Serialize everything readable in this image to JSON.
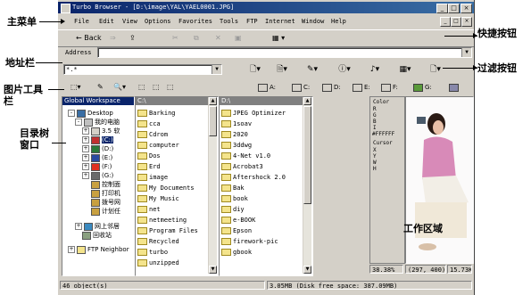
{
  "window": {
    "title": "Turbo Browser - [D:\\image\\YAL\\YAEL0001.JPG]",
    "controls": [
      "_",
      "□",
      "×"
    ],
    "mdi_controls": [
      "_",
      "□",
      "×"
    ]
  },
  "menu": [
    "File",
    "Edit",
    "View",
    "Options",
    "Favorites",
    "Tools",
    "FTP",
    "Internet",
    "Window",
    "Help"
  ],
  "toolbar": {
    "back_label": "← Back",
    "forward": "⇒",
    "up": "⇪",
    "cut": "✂",
    "copy": "⧉",
    "delete": "✕",
    "properties": "▣",
    "view": "▦ ▾"
  },
  "address": {
    "label": "Address",
    "value": ""
  },
  "filter": {
    "value": "*.*",
    "buttons": [
      "🗋▾",
      "🗎▾",
      "✎▾",
      "ⓘ▾",
      "♪▾",
      "▦▾",
      "🗋▾"
    ]
  },
  "image_tools": [
    "⬚▾",
    "✎",
    "🔍▾",
    "⬚",
    "⬚",
    "⬚"
  ],
  "drives": [
    "A:",
    "C:",
    "D:",
    "E:",
    "F:",
    "G:"
  ],
  "tree": {
    "header": "Global Workspace",
    "items": [
      "Desktop",
      "我的电脑",
      "3.5 软",
      "(C:)",
      "(D:)",
      "(E:)",
      "(F:)",
      "(G:)",
      "控制面",
      "打印机",
      "拨号网",
      "计划任",
      "网上邻居",
      "回收站",
      "FTP Neighbor"
    ]
  },
  "panel1": {
    "header": "C:\\",
    "items": [
      "Barking",
      "cca",
      "Cdrom",
      "computer",
      "Dos",
      "Erd",
      "image",
      "My Documents",
      "My Music",
      "net",
      "netmeeting",
      "Program Files",
      "Recycled",
      "turbo",
      "unzipped"
    ]
  },
  "panel2": {
    "header": "D:\\",
    "items": [
      "JPEG Optimizer",
      "1soav",
      "2020",
      "3ddwg",
      "4-Net v1.0",
      "Acrobat3",
      "Aftershock 2.0",
      "Bak",
      "book",
      "diy",
      "e-BOOK",
      "Epson",
      "firework-pic",
      "gbook"
    ]
  },
  "info_panel": {
    "color_label": "Color",
    "color_rows": [
      "R",
      "G",
      "B",
      "I"
    ],
    "color_hex": "#FFFFFF",
    "cursor_label": "Cursor",
    "cursor_rows": [
      "X",
      "Y",
      "W",
      "H"
    ]
  },
  "status": {
    "objects": "46 object(s)",
    "disk": "3.05MB (Disk free space: 387.09MB)",
    "zoom": "38.38%",
    "coords": "(297, 400)",
    "size": "15.73KB"
  },
  "annotations": {
    "main_menu": "主菜单",
    "address_bar": "地址栏",
    "image_toolbar": "图片工具\n栏",
    "dir_tree": "目录树\n窗口",
    "shortcut_buttons": "快捷按钮",
    "filter_buttons": "过滤按钮",
    "work_area": "工作区域"
  },
  "colors": {
    "titlebar": "#0a246a",
    "face": "#d4d0c8",
    "folder": "#f4e48c"
  }
}
